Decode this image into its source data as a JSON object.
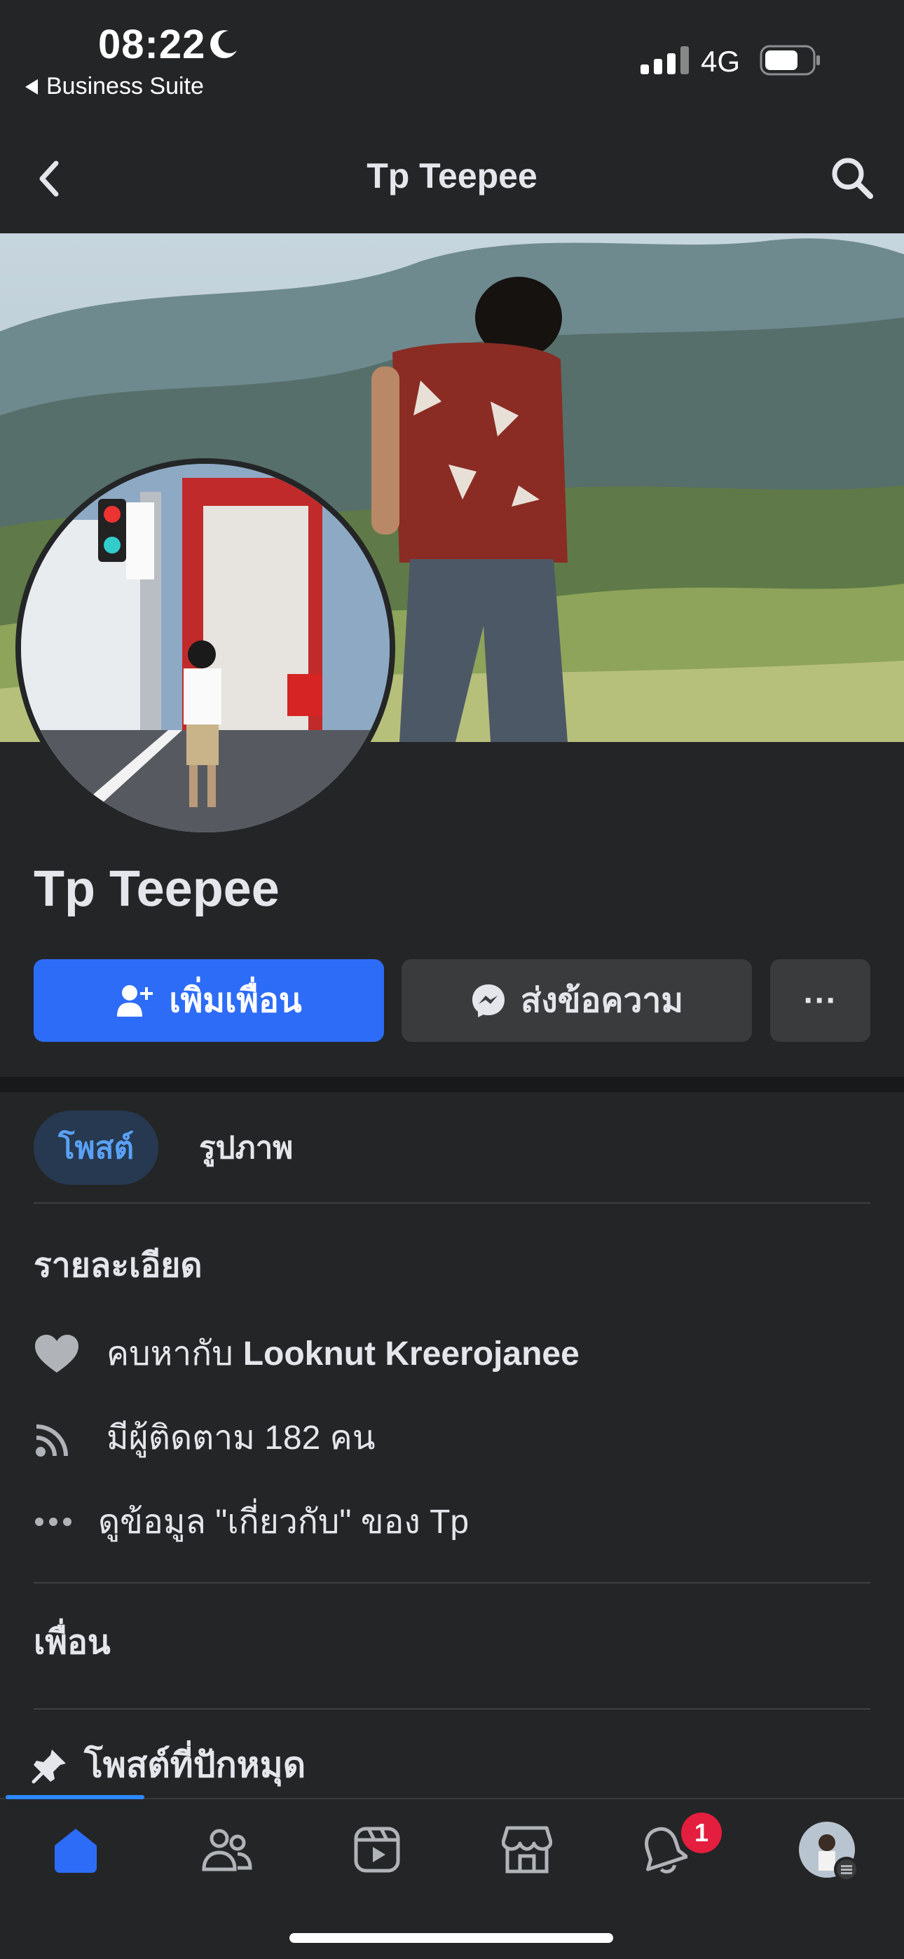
{
  "status_bar": {
    "time": "08:22",
    "back_app": "Business Suite",
    "network": "4G",
    "battery_level": 0.7,
    "icons": [
      "moon-icon",
      "signal-icon",
      "battery-icon"
    ]
  },
  "header": {
    "title": "Tp Teepee",
    "icons": [
      "back-chevron-icon",
      "search-icon"
    ]
  },
  "profile": {
    "name": "Tp Teepee",
    "cover_image": "cover-photo",
    "avatar_image": "profile-photo"
  },
  "actions": {
    "add_friend": "เพิ่มเพื่อน",
    "message": "ส่งข้อความ",
    "more": "···"
  },
  "tabs": {
    "posts": "โพสต์",
    "photos": "รูปภาพ"
  },
  "details": {
    "title": "รายละเอียด",
    "relationship_prefix": "คบหากับ",
    "relationship_name": "Looknut Kreerojanee",
    "followers": "มีผู้ติดตาม 182 คน",
    "about": "ดูข้อมูล \"เกี่ยวกับ\" ของ Tp"
  },
  "friends": {
    "title": "เพื่อน"
  },
  "pinned": {
    "label": "โพสต์ที่ปักหมุด"
  },
  "bottom_nav": {
    "items": [
      "home-icon",
      "friends-icon",
      "video-icon",
      "marketplace-icon",
      "notifications-icon",
      "profile-menu-icon"
    ],
    "notification_count": "1",
    "accent": "#2d6cf7"
  },
  "colors": {
    "background": "#242526",
    "primary_button": "#2d6cf7",
    "secondary_button": "#3a3b3c",
    "badge": "#e41e3f"
  }
}
